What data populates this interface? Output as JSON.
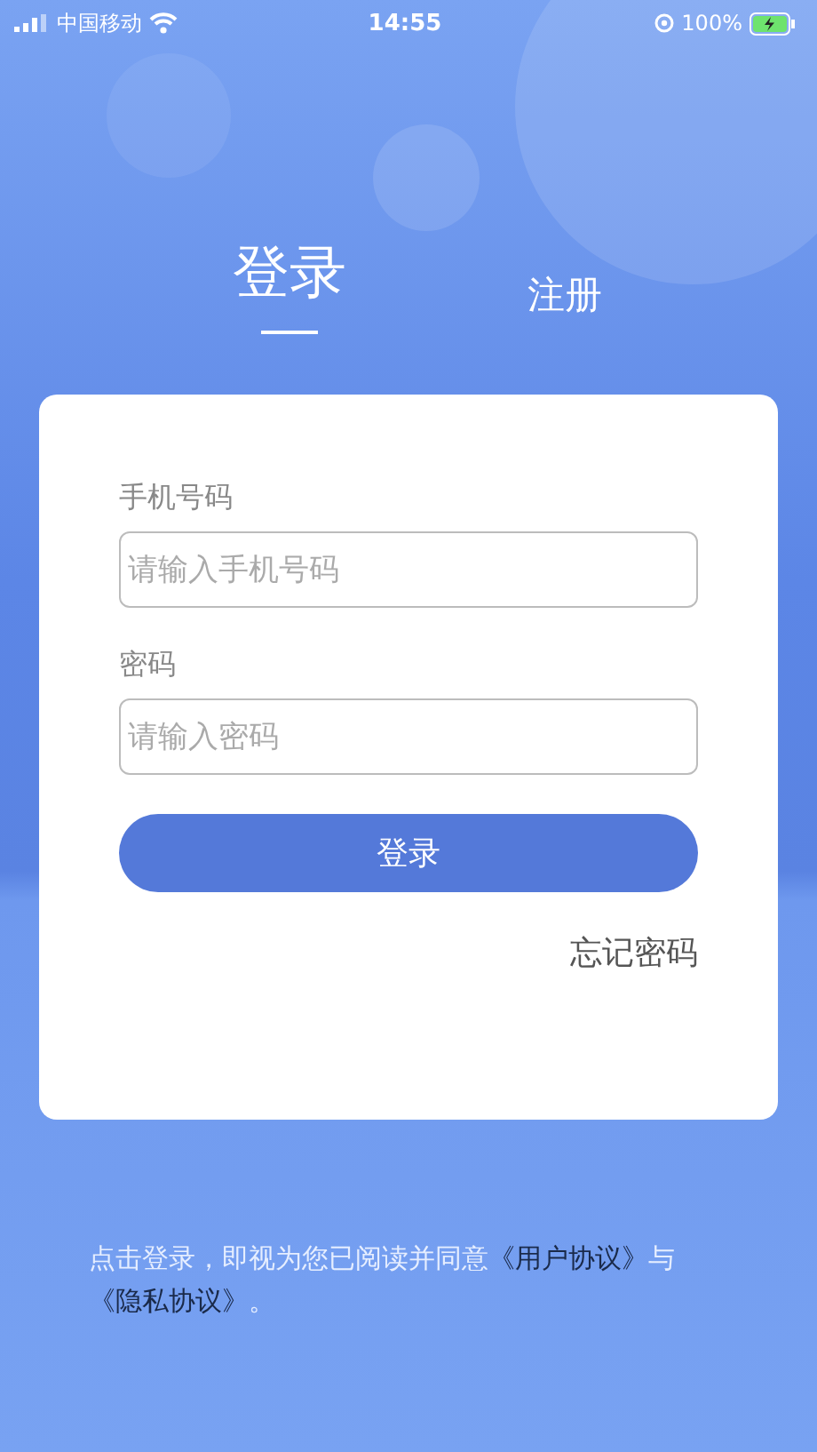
{
  "status_bar": {
    "carrier": "中国移动",
    "time": "14:55",
    "battery": "100%"
  },
  "tabs": [
    {
      "label": "登录",
      "selected": true
    },
    {
      "label": "注册",
      "selected": false
    }
  ],
  "form": {
    "fields": [
      {
        "label": "手机号码",
        "placeholder": "请输入手机号码"
      },
      {
        "label": "密码",
        "placeholder": "请输入密码"
      }
    ],
    "submit": "登录",
    "forgot_password": "忘记密码"
  },
  "agreement": {
    "text": "点击登录，即视为您已阅读并同意",
    "user_agreement": "《用户协议》",
    "conjunction": "与",
    "privacy_agreement": "《隐私协议》",
    "ending": "。"
  }
}
